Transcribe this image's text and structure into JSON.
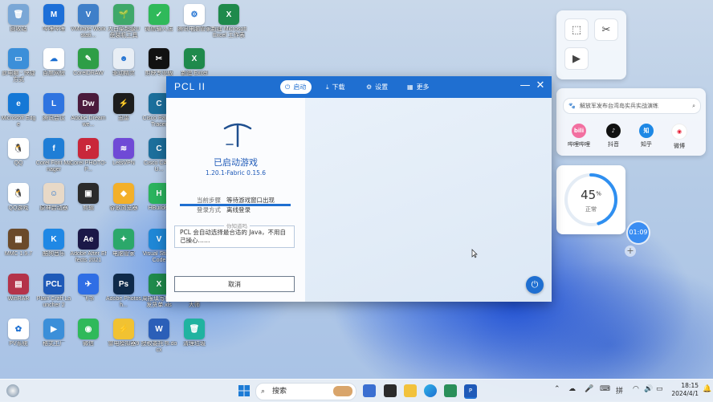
{
  "desktop": {
    "icons": [
      {
        "label": "回收站",
        "color": "#7aa7d6",
        "glyph": "🗑"
      },
      {
        "label": "哔哩哔哩",
        "color": "#1d6fd8",
        "glyph": "M"
      },
      {
        "label": "VMware Workstati...",
        "color": "#3f7fc9",
        "glyph": "V"
      },
      {
        "label": "大白菜超级U盘装机工具",
        "color": "#3fa86a",
        "glyph": "🌱"
      },
      {
        "label": "微信输入法",
        "color": "#2fb95a",
        "glyph": "✓"
      },
      {
        "label": "腾讯电脑管家",
        "color": "#ffffff",
        "glyph": "⚙"
      },
      {
        "label": "新建 Microsoft Excel 工作表",
        "color": "#1f8a4c",
        "glyph": "X"
      },
      {
        "label": "此电脑 - 快捷方式",
        "color": "#3b8fd9",
        "glyph": "▭"
      },
      {
        "label": "百度网盘",
        "color": "#ffffff",
        "glyph": "☁"
      },
      {
        "label": "CorelDRAW",
        "color": "#2e9e46",
        "glyph": "✎"
      },
      {
        "label": "驱动精灵",
        "color": "#e8eef5",
        "glyph": "☻"
      },
      {
        "label": "剪映专业版",
        "color": "#111111",
        "glyph": "✂"
      },
      {
        "label": "新建 Excel",
        "color": "#1f8a4c",
        "glyph": "X"
      },
      {
        "label": "Microsoft Edge",
        "color": "#1578d6",
        "glyph": "e"
      },
      {
        "label": "腾讯会议",
        "color": "#2f74e0",
        "glyph": "L"
      },
      {
        "label": "Adobe Dreamwe...",
        "color": "#4b1b3c",
        "glyph": "Dw"
      },
      {
        "label": "迅雷",
        "color": "#1d1d1d",
        "glyph": "⚡"
      },
      {
        "label": "Cisco Packet Tracer",
        "color": "#1c6f9c",
        "glyph": "C"
      },
      {
        "label": "QQ",
        "color": "#ffffff",
        "glyph": "🐧"
      },
      {
        "label": "Corel Font Manager",
        "color": "#1f7ed6",
        "glyph": "f"
      },
      {
        "label": "Corel PHOTO-P...",
        "color": "#c9273a",
        "glyph": "P"
      },
      {
        "label": "LetsVPN",
        "color": "#6f4ad6",
        "glyph": "≋"
      },
      {
        "label": "Cisco CAPTU...",
        "color": "#1c6f9c",
        "glyph": "C"
      },
      {
        "label": "QQ游戏",
        "color": "#ffffff",
        "glyph": "🐧"
      },
      {
        "label": "原神启动器",
        "color": "#e8d9c7",
        "glyph": "☺"
      },
      {
        "label": "剪辑",
        "color": "#2b2b2b",
        "glyph": "▣"
      },
      {
        "label": "谷歌浏览器",
        "color": "#f3b02a",
        "glyph": "◆"
      },
      {
        "label": "HBuilder",
        "color": "#2bb35e",
        "glyph": "H"
      },
      {
        "label": "MMC 1.9.7",
        "color": "#6b4a2a",
        "glyph": "▦"
      },
      {
        "label": "酷狗音乐",
        "color": "#1f88e5",
        "glyph": "K"
      },
      {
        "label": "Adobe After Effects 2021",
        "color": "#1b1847",
        "glyph": "Ae"
      },
      {
        "label": "电脑管家",
        "color": "#2ba86a",
        "glyph": "✦"
      },
      {
        "label": "Visual Studio Code",
        "color": "#1f87d6",
        "glyph": "V"
      },
      {
        "label": "WinRAR",
        "color": "#b4334a",
        "glyph": "▤"
      },
      {
        "label": "Plain Craft Launcher 2",
        "color": "#1f5ab8",
        "glyph": "PCL"
      },
      {
        "label": "飞书",
        "color": "#2f6ee5",
        "glyph": "✈"
      },
      {
        "label": "Adobe Photosh...",
        "color": "#0f2a4a",
        "glyph": "Ps"
      },
      {
        "label": "周报填写模板发货单.xls",
        "color": "#1f8a4c",
        "glyph": "X"
      },
      {
        "label": "Windows 优化大师",
        "color": "#2b6fd1",
        "glyph": "W"
      },
      {
        "label": "PV系统",
        "color": "#ffffff",
        "glyph": "✿"
      },
      {
        "label": "格式工厂",
        "color": "#3b8fd9",
        "glyph": "▶"
      },
      {
        "label": "微信",
        "color": "#2fb95a",
        "glyph": "◉"
      },
      {
        "label": "雷电模拟器9",
        "color": "#f1c232",
        "glyph": "⚡"
      },
      {
        "label": "授权委托书.docx",
        "color": "#2b5fb8",
        "glyph": "W"
      },
      {
        "label": "清理垃圾",
        "color": "#20b3a0",
        "glyph": "🗑"
      }
    ]
  },
  "widgets": {
    "search_placeholder": "解放军发布台湾岛实兵实战演练",
    "apps": [
      {
        "label": "哔哩哔哩",
        "color": "#f26fa0",
        "glyph": "bili"
      },
      {
        "label": "抖音",
        "color": "#111111",
        "glyph": "♪"
      },
      {
        "label": "知乎",
        "color": "#1e88e5",
        "glyph": "知"
      },
      {
        "label": "微博",
        "color": "#ffffff",
        "glyph": "◉"
      }
    ],
    "gauge": {
      "value": "45",
      "unit": "%",
      "status": "正常",
      "fraction": 0.45
    },
    "clock_bubble": "01:09"
  },
  "window": {
    "title": "PCL II",
    "tabs": [
      {
        "label": "启动",
        "icon": "⏻",
        "active": true
      },
      {
        "label": "下载",
        "icon": "⤓",
        "active": false
      },
      {
        "label": "设置",
        "icon": "⚙",
        "active": false
      },
      {
        "label": "更多",
        "icon": "▦",
        "active": false
      }
    ],
    "status_title": "已启动游戏",
    "version": "1.20.1-Fabric 0.15.6",
    "progress": 1.0,
    "step_label": "当前步骤",
    "step_value": "等待游戏窗口出现",
    "login_label": "登录方式",
    "login_value": "离线登录",
    "tip_caption": "你知道吗",
    "tip_text": "PCL 会自动选择最合适的 Java，不用自己操心……",
    "cancel_label": "取消"
  },
  "taskbar": {
    "search_label": "搜索",
    "ime": "拼",
    "time": "18:15",
    "date": "2024/4/1"
  }
}
